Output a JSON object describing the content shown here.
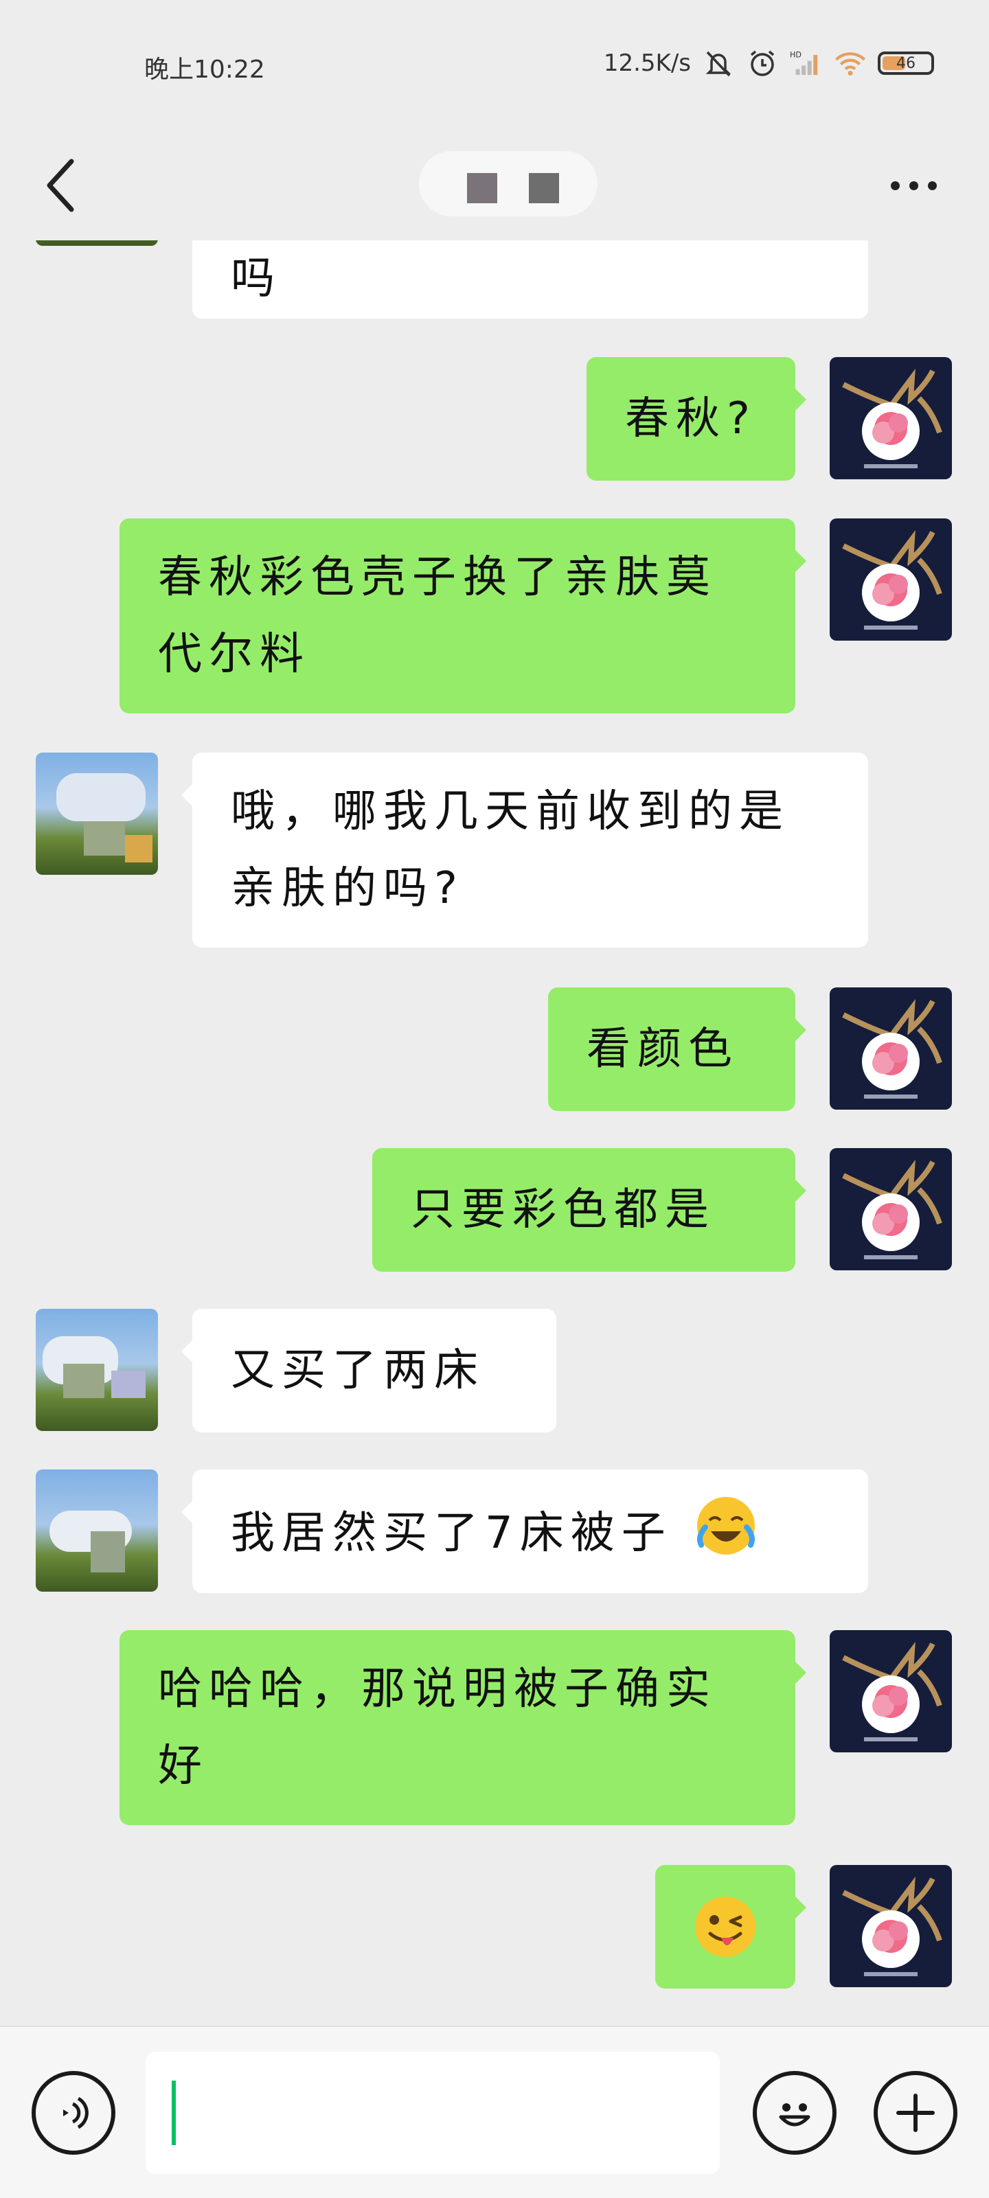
{
  "status_bar": {
    "time": "晚上10:22",
    "net_speed": "12.5K/s",
    "battery_level": "46",
    "icons": [
      "mute-bell-icon",
      "alarm-icon",
      "hd-signal-icon",
      "wifi-icon",
      "battery-icon"
    ]
  },
  "nav": {
    "back_icon": "chevron-left-icon",
    "more_icon": "more-dots-icon"
  },
  "messages": [
    {
      "side": "in",
      "text": "吗"
    },
    {
      "side": "out",
      "text": "春秋?"
    },
    {
      "side": "out",
      "text": "春秋彩色壳子换了亲肤莫代尔料"
    },
    {
      "side": "in",
      "text": "哦，哪我几天前收到的是亲肤的吗?"
    },
    {
      "side": "out",
      "text": "看颜色"
    },
    {
      "side": "out",
      "text": "只要彩色都是"
    },
    {
      "side": "in",
      "text": "又买了两床"
    },
    {
      "side": "in",
      "text": "我居然买了7床被子",
      "emoji": "laugh-cry-emoji"
    },
    {
      "side": "out",
      "text": "哈哈哈，那说明被子确实好"
    },
    {
      "side": "out",
      "text": "",
      "emoji": "wink-tongue-emoji"
    }
  ],
  "input_bar": {
    "voice_icon": "voice-icon",
    "emoji_icon": "smiley-icon",
    "plus_icon": "plus-icon",
    "input_value": ""
  },
  "colors": {
    "background": "#ededed",
    "outgoing_bubble": "#95ec69",
    "incoming_bubble": "#ffffff",
    "caret": "#07c160"
  }
}
